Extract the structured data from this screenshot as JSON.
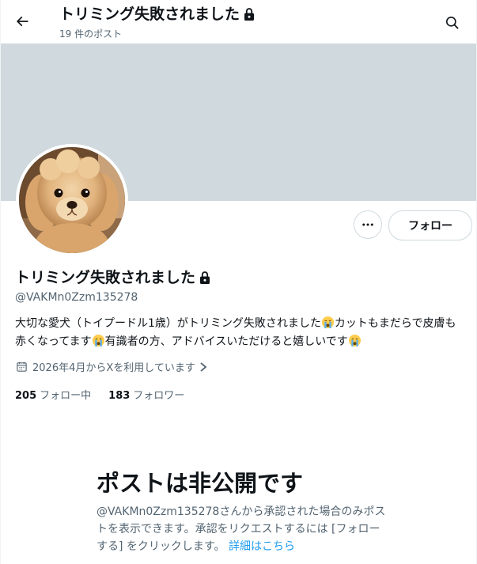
{
  "header": {
    "title": "トリミング失敗されました",
    "post_count": "19 件のポスト"
  },
  "profile": {
    "name": "トリミング失敗されました",
    "handle": "@VAKMn0Zzm135278",
    "bio_part1": "大切な愛犬（トイプードル1歳）がトリミング失敗されました",
    "bio_part2": "カットもまだらで皮膚も赤くなってます",
    "bio_part3": "有識者の方、アドバイスいただけると嬉しいです",
    "bio_emoji": "crying-face-icon",
    "joined": "2026年4月からXを利用しています",
    "following_count": "205",
    "following_label": "フォロー中",
    "followers_count": "183",
    "followers_label": "フォロワー"
  },
  "actions": {
    "follow_label": "フォロー",
    "more_icon": "more-icon"
  },
  "private_notice": {
    "title": "ポストは非公開です",
    "description": "@VAKMn0Zzm135278さんから承認された場合のみポストを表示できます。承認をリクエストするには [フォローする] をクリックします。",
    "link_label": "詳細はこちら"
  },
  "colors": {
    "banner": "#cfd9de",
    "text_primary": "#0f1419",
    "text_secondary": "#536471",
    "link": "#1d9bf0"
  }
}
